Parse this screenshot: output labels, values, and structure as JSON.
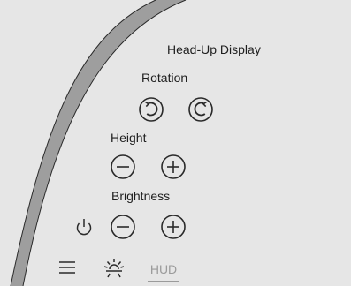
{
  "panel": {
    "title": "Head-Up Display",
    "rotation_label": "Rotation",
    "height_label": "Height",
    "brightness_label": "Brightness"
  },
  "icons": {
    "rotate_left": "rotate-counterclockwise-icon",
    "rotate_right": "rotate-clockwise-icon",
    "height_decrease": "minus-circle-icon",
    "height_increase": "plus-circle-icon",
    "brightness_decrease": "minus-circle-icon",
    "brightness_increase": "plus-circle-icon",
    "power": "power-icon",
    "menu": "hamburger-menu-icon",
    "sun": "sun-icon"
  },
  "bottom_bar": {
    "hud_tab_label": "HUD"
  },
  "colors": {
    "background": "#e6e6e6",
    "bezel_fill": "#9e9e9e",
    "icon_stroke": "#2a2a2a",
    "inactive_tab": "#9b9b9b"
  }
}
